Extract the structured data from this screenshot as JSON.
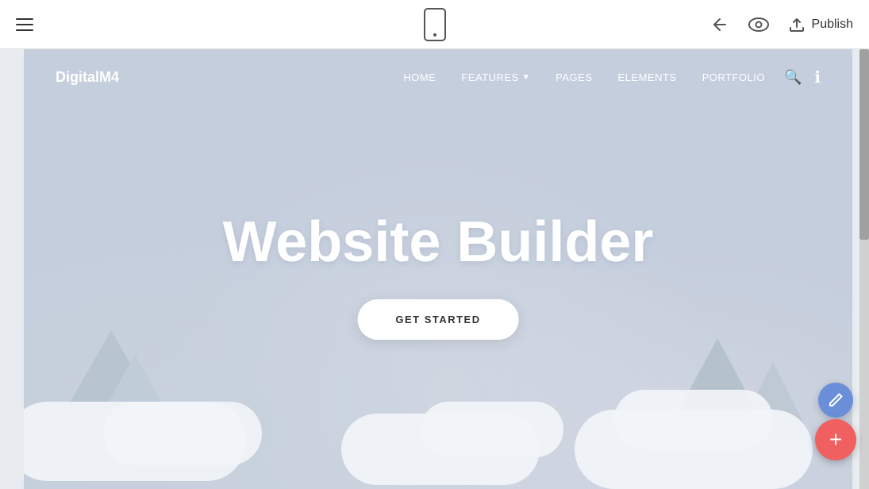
{
  "toolbar": {
    "hamburger_label": "menu",
    "publish_label": "Publish",
    "back_label": "back",
    "preview_label": "preview"
  },
  "preview": {
    "nav": {
      "logo": "DigitalM4",
      "links": [
        {
          "label": "HOME",
          "has_arrow": false
        },
        {
          "label": "FEATURES",
          "has_arrow": true
        },
        {
          "label": "PAGES",
          "has_arrow": false
        },
        {
          "label": "ELEMENTS",
          "has_arrow": false
        },
        {
          "label": "PORTFOLIO",
          "has_arrow": false
        }
      ]
    },
    "hero": {
      "title": "Website Builder",
      "cta_label": "GET STARTED"
    }
  },
  "fab": {
    "edit_icon": "pencil",
    "add_icon": "+"
  }
}
